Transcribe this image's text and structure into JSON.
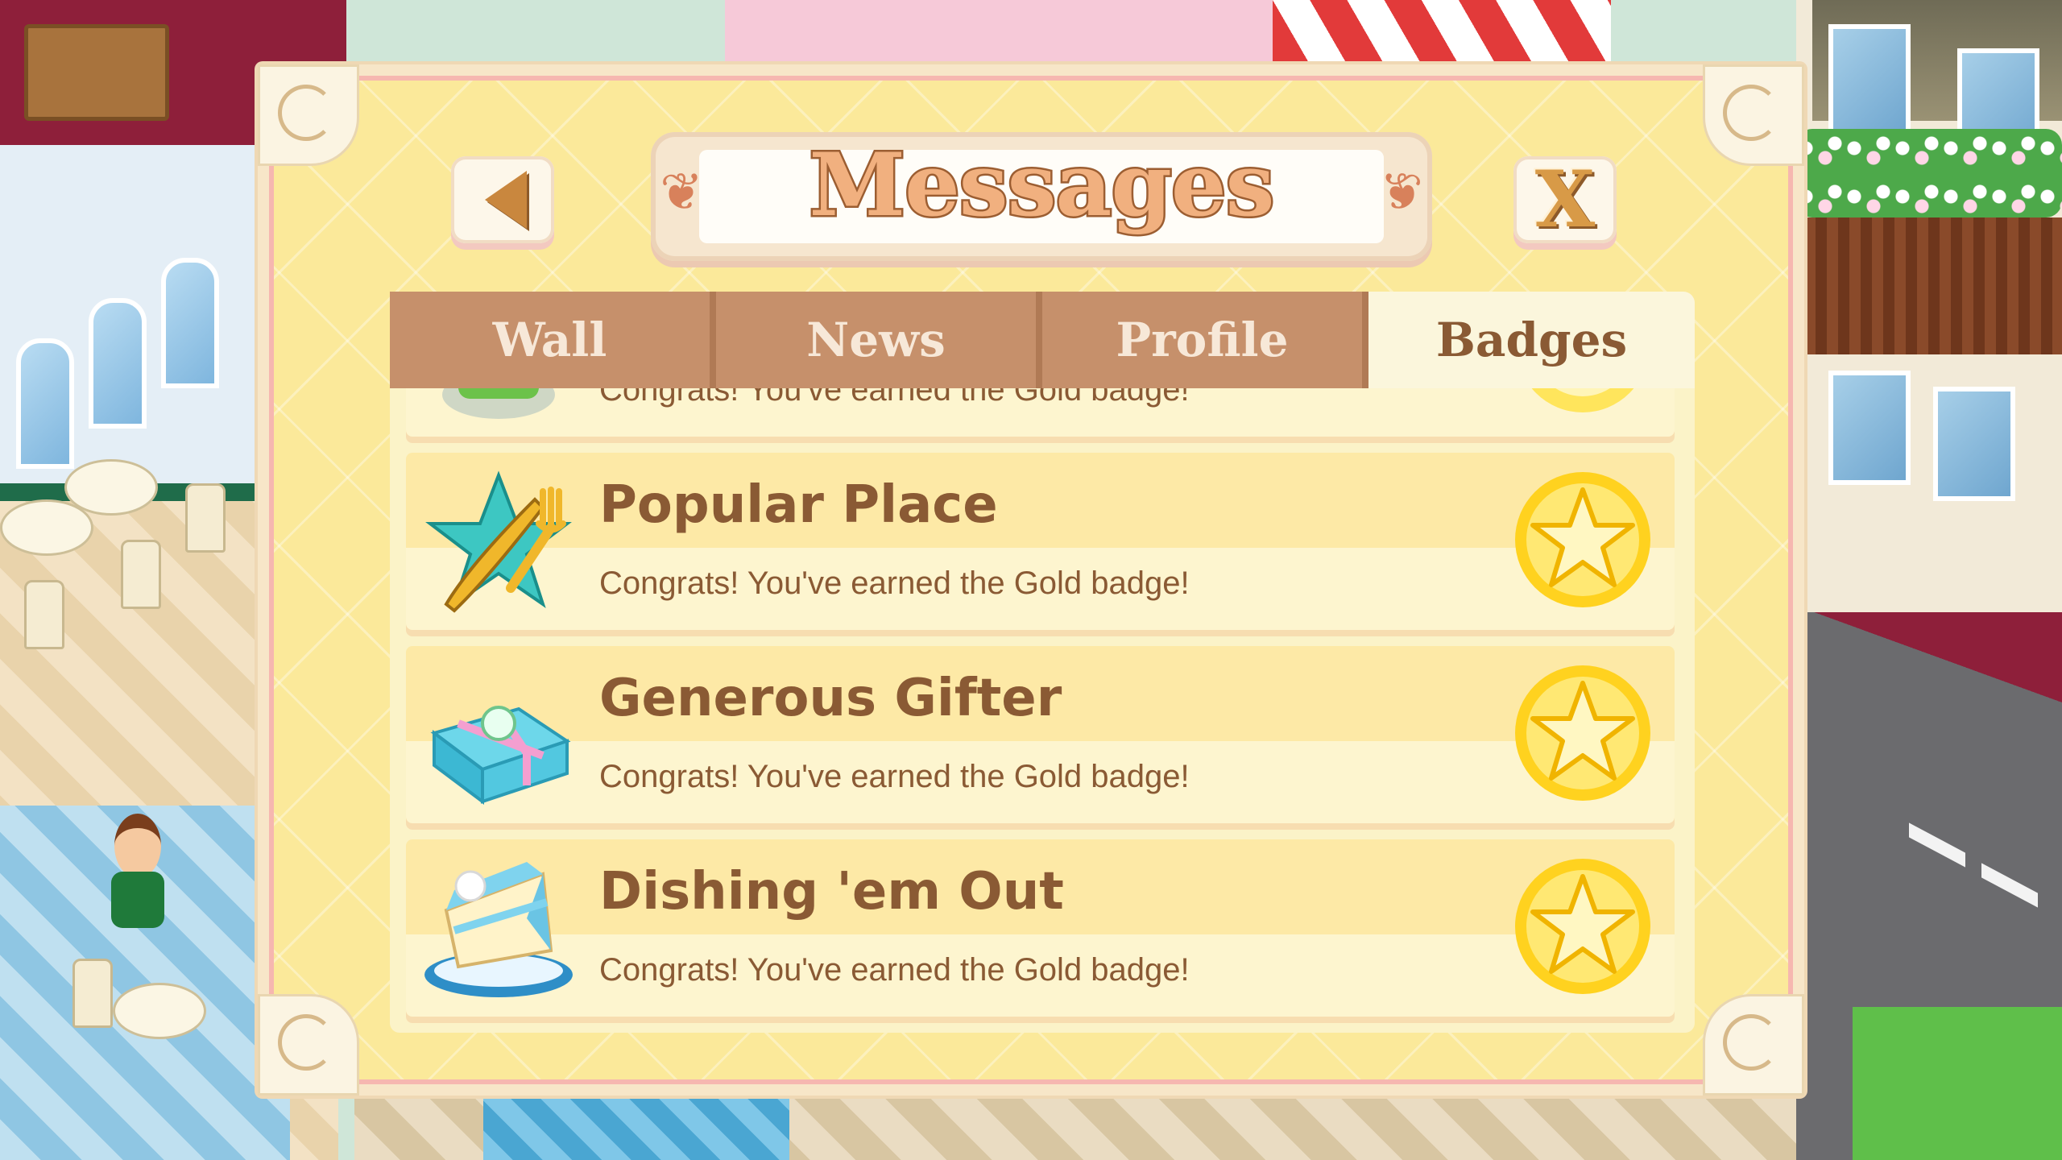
{
  "dialog": {
    "title": "Messages",
    "back_icon": "left-arrow-icon",
    "close_label": "X"
  },
  "tabs": [
    {
      "label": "Wall",
      "active": false
    },
    {
      "label": "News",
      "active": false
    },
    {
      "label": "Profile",
      "active": false
    },
    {
      "label": "Badges",
      "active": true
    }
  ],
  "badges": [
    {
      "title": "",
      "message": "Congrats! You've earned the Gold badge!",
      "icon": "green-badge-icon",
      "level": "gold"
    },
    {
      "title": "Popular Place",
      "message": "Congrats! You've earned the Gold badge!",
      "icon": "fork-knife-star-icon",
      "level": "gold"
    },
    {
      "title": "Generous Gifter",
      "message": "Congrats! You've earned the Gold badge!",
      "icon": "gift-box-icon",
      "level": "gold"
    },
    {
      "title": "Dishing 'em Out",
      "message": "Congrats! You've earned the Gold badge!",
      "icon": "cake-slice-icon",
      "level": "gold"
    }
  ],
  "colors": {
    "panel": "#fbe99a",
    "tab_inactive": "#c6906b",
    "tab_active": "#fbf6dc",
    "text_brown": "#8a5a34",
    "gold": "#ffd21f"
  }
}
